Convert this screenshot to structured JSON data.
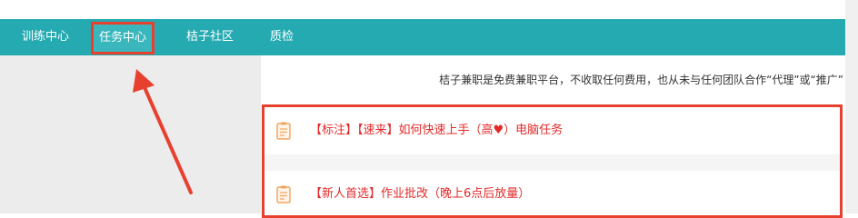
{
  "nav": {
    "items": [
      {
        "label": "训练中心"
      },
      {
        "label": "任务中心"
      },
      {
        "label": "桔子社区"
      },
      {
        "label": "质检"
      }
    ]
  },
  "notice": "桔子兼职是免费兼职平台，不收取任何费用，也从未与任何团队合作“代理”或“推广”",
  "tasks": [
    {
      "prefix": "【标注】【速来】如何快速上手（高",
      "heart": "♥",
      "suffix": "）电脑任务",
      "icon": "document-icon"
    },
    {
      "title": "【新人首选】作业批改（晚上6点后放量）",
      "icon": "document-icon"
    }
  ],
  "colors": {
    "nav_bg": "#25aab1",
    "highlight": "#e8402f",
    "task_text": "#e32a2a",
    "icon": "#f2a35b"
  }
}
